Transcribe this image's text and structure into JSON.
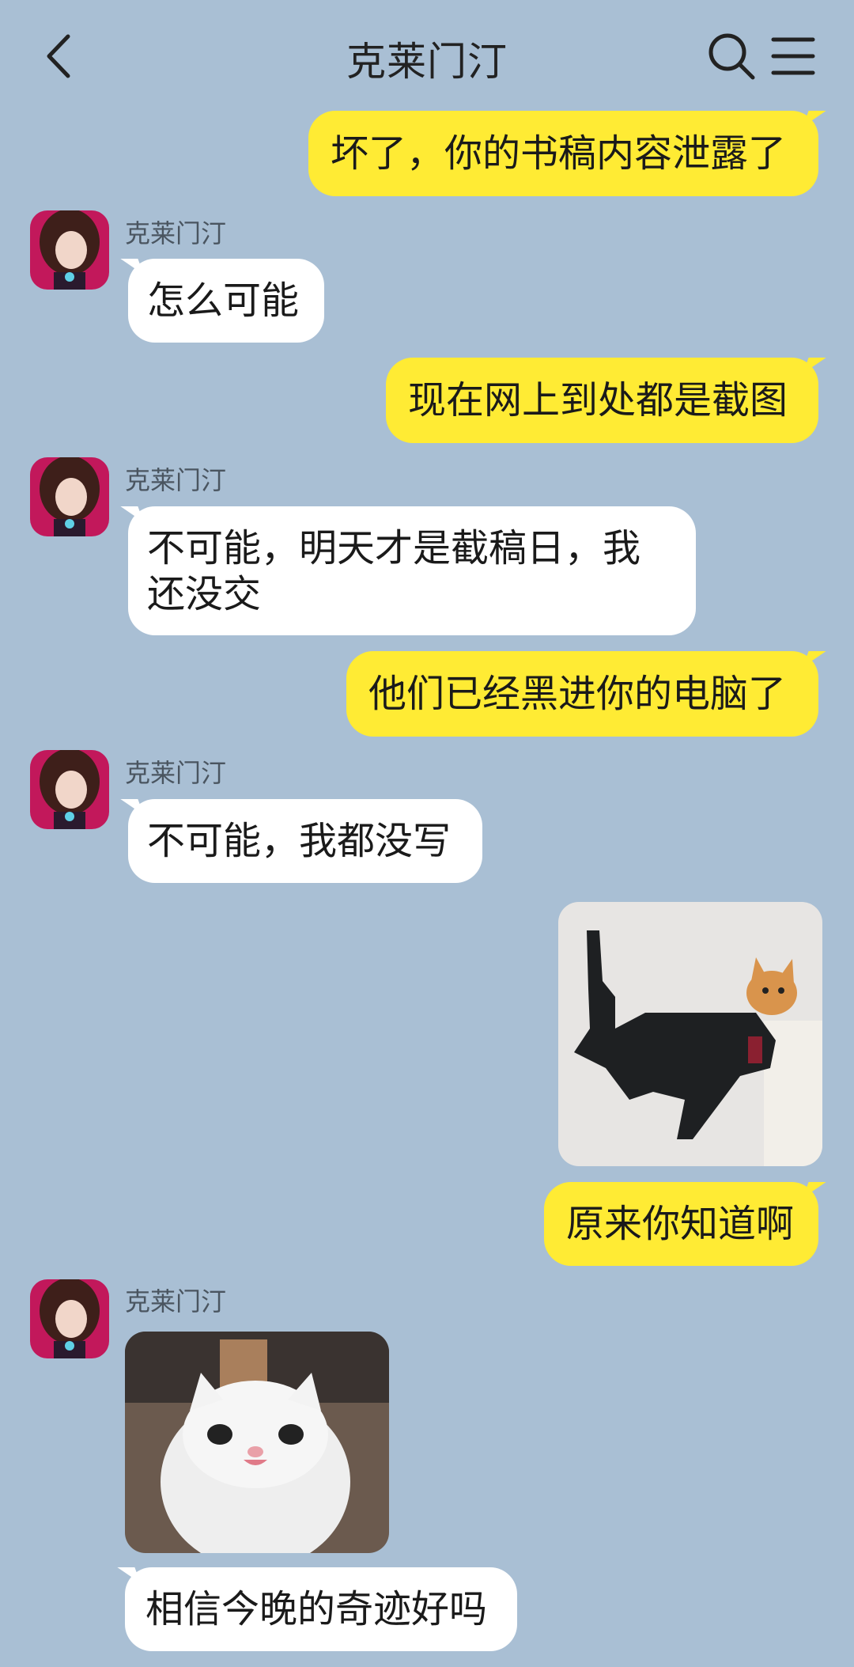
{
  "header": {
    "title": "克莱门汀",
    "back_icon": "chevron-left-icon",
    "search_icon": "search-icon",
    "menu_icon": "menu-icon"
  },
  "colors": {
    "background": "#a9bfd4",
    "my_bubble": "#ffeb34",
    "their_bubble": "#ffffff"
  },
  "messages": [
    {
      "from": "me",
      "text": "坏了，你的书稿内容泄露了"
    },
    {
      "from": "them",
      "sender": "克莱门汀",
      "text": "怎么可能"
    },
    {
      "from": "me",
      "text": "现在网上到处都是截图"
    },
    {
      "from": "them",
      "sender": "克莱门汀",
      "text_line1": "不可能，明天才是截稿日，我",
      "text_line2": "还没交"
    },
    {
      "from": "me",
      "text": "他们已经黑进你的电脑了"
    },
    {
      "from": "them",
      "sender": "克莱门汀",
      "text": "不可能，我都没写"
    },
    {
      "from": "me",
      "image": "cat-with-gun-sticker"
    },
    {
      "from": "me",
      "text": "原来你知道啊"
    },
    {
      "from": "them",
      "sender": "克莱门汀",
      "image": "smiling-white-cat-sticker"
    },
    {
      "from": "them",
      "text": "相信今晚的奇迹好吗"
    }
  ]
}
